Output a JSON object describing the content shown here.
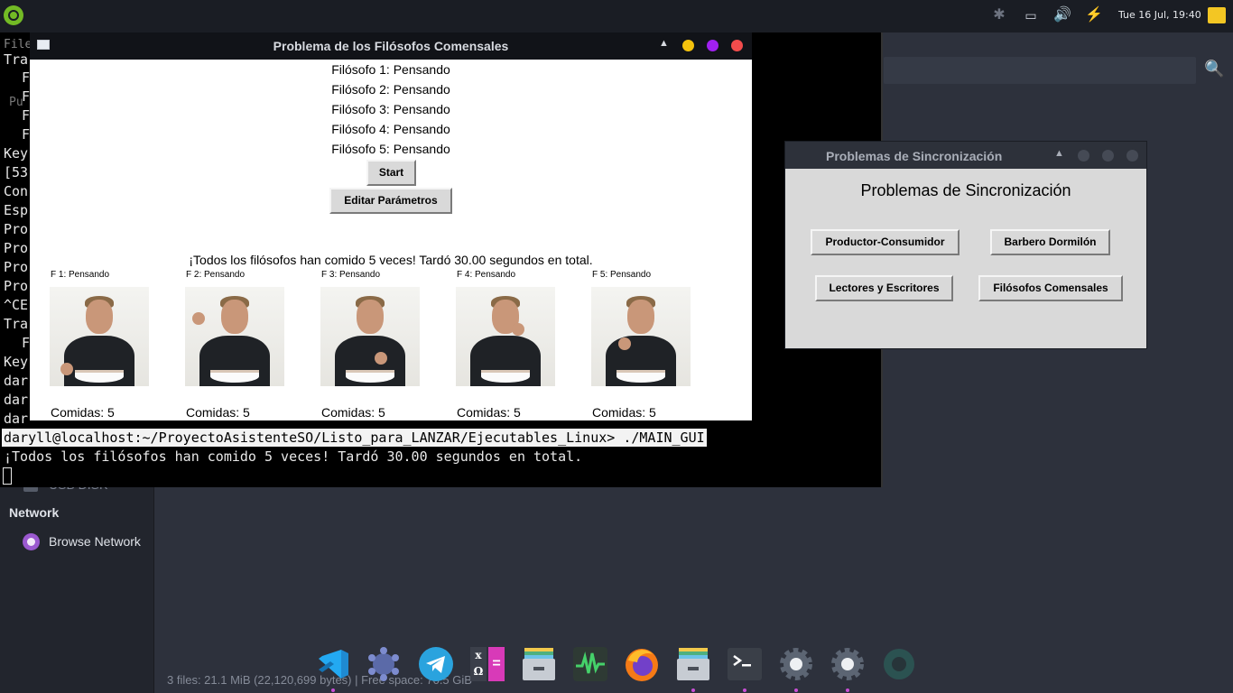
{
  "topbar": {
    "clock": "Tue 16 Jul, 19:40",
    "tray_icons": [
      "bluetooth-icon",
      "display-icon",
      "volume-icon",
      "battery-charging-icon"
    ]
  },
  "terminal": {
    "partial_lines": [
      "File",
      "Tra",
      "F",
      "F",
      "Pu",
      "F",
      "F",
      "Key",
      "[53",
      "Con",
      "Esp",
      "Pro",
      "Pro",
      "Pro",
      "Pro",
      "^CE",
      "Tra",
      "F",
      "Key",
      "dar",
      "dar",
      "dar"
    ],
    "command": "daryll@localhost:~/ProyectoAsistenteSO/Listo_para_LANZAR/Ejecutables_Linux> ./MAIN_GUI",
    "output": "¡Todos los filósofos han comido 5 veces! Tardó 30.00 segundos en total."
  },
  "file_manager": {
    "usb_label": "USB DISK",
    "network_heading": "Network",
    "browse_network": "Browse Network",
    "status": "3 files: 21.1 MiB (22,120,699 bytes) | Free space: 70.5 GiB"
  },
  "philosophers_window": {
    "title": "Problema de los Filósofos Comensales",
    "statuses": [
      "Filósofo 1: Pensando",
      "Filósofo 2: Pensando",
      "Filósofo 3: Pensando",
      "Filósofo 4: Pensando",
      "Filósofo 5: Pensando"
    ],
    "start_button": "Start",
    "edit_button": "Editar Parámetros",
    "message": "¡Todos los filósofos han comido 5 veces! Tardó 30.00 segundos en total.",
    "philosophers": [
      {
        "caption": "F 1: Pensando",
        "meals": "Comidas: 5"
      },
      {
        "caption": "F 2: Pensando",
        "meals": "Comidas: 5"
      },
      {
        "caption": "F 3: Pensando",
        "meals": "Comidas: 5"
      },
      {
        "caption": "F 4: Pensando",
        "meals": "Comidas: 5"
      },
      {
        "caption": "F 5: Pensando",
        "meals": "Comidas: 5"
      }
    ],
    "window_button_colors": {
      "minimize": "#f4c20d",
      "maximize": "#a020f0",
      "close": "#f24c4c"
    }
  },
  "sync_window": {
    "title": "Problemas de Sincronización",
    "heading": "Problemas de Sincronización",
    "buttons": {
      "productor": "Productor-Consumidor",
      "barbero": "Barbero Dormilón",
      "lectores": "Lectores y Escritores",
      "filosofos": "Filósofos Comensales"
    }
  },
  "dock": {
    "apps": [
      "vscode-icon",
      "app-grid-icon",
      "telegram-icon",
      "calculator-icon",
      "files-icon",
      "system-monitor-icon",
      "firefox-icon",
      "files-icon",
      "terminal-icon",
      "settings-icon",
      "settings-icon"
    ],
    "calculator_glyphs": [
      "x",
      "Ω",
      "="
    ]
  }
}
